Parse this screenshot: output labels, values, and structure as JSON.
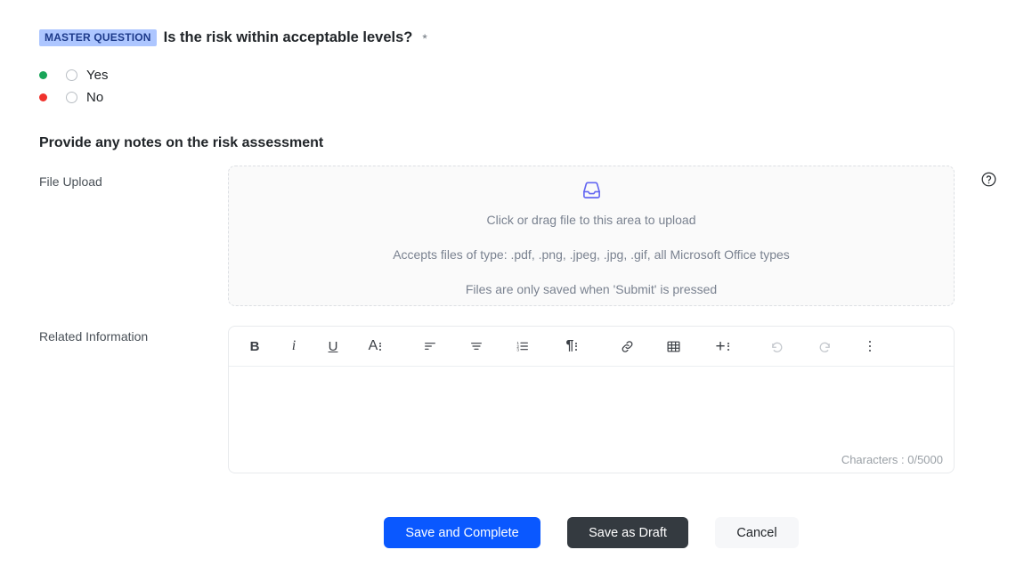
{
  "master_question": {
    "badge": "MASTER QUESTION",
    "title": "Is the risk within acceptable levels?",
    "required_marker": "*",
    "options": [
      {
        "label": "Yes",
        "status_color": "#18a558",
        "selected": false
      },
      {
        "label": "No",
        "status_color": "#f0322c",
        "selected": false
      }
    ]
  },
  "section": {
    "heading": "Provide any notes on the risk assessment"
  },
  "file_upload": {
    "label": "File Upload",
    "icon": "inbox-tray-icon",
    "icon_color": "#6366f1",
    "primary_text": "Click or drag file to this area to upload",
    "accepted_types_text": "Accepts files of type: .pdf, .png, .jpeg, .jpg, .gif, all Microsoft Office types",
    "save_note_text": "Files are only saved when 'Submit' is pressed",
    "help_icon": "question-circle-icon"
  },
  "related_information": {
    "label": "Related Information",
    "value": "",
    "character_counter": "Characters : 0/5000",
    "toolbar": [
      {
        "name": "bold",
        "glyph": "B"
      },
      {
        "name": "italic",
        "glyph": "i"
      },
      {
        "name": "underline",
        "glyph": "U"
      },
      {
        "name": "font-style",
        "glyph": "A"
      },
      {
        "name": "align-left",
        "glyph": ""
      },
      {
        "name": "align-center",
        "glyph": ""
      },
      {
        "name": "ordered-list",
        "glyph": ""
      },
      {
        "name": "paragraph-format",
        "glyph": "¶"
      },
      {
        "name": "insert-link",
        "glyph": ""
      },
      {
        "name": "insert-table",
        "glyph": ""
      },
      {
        "name": "insert-more",
        "glyph": "+"
      },
      {
        "name": "undo",
        "glyph": ""
      },
      {
        "name": "redo",
        "glyph": ""
      },
      {
        "name": "more-options",
        "glyph": ""
      }
    ]
  },
  "footer": {
    "save_and_complete": "Save and Complete",
    "save_as_draft": "Save as Draft",
    "cancel": "Cancel",
    "primary_color": "#0a58ff",
    "dark_color": "#343a40"
  }
}
